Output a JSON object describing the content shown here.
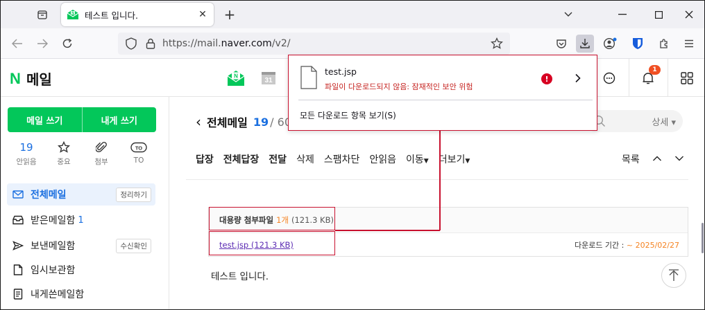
{
  "browser": {
    "tab_title": "테스트 입니다.",
    "url_prefix": "https://mail.",
    "url_domain": "naver.com",
    "url_path": "/v2/"
  },
  "download": {
    "file_name": "test.jsp",
    "status": "파일이 다운로드되지 않음: 잠재적인 보안 위험",
    "show_all": "모든 다운로드 항목 보기(S)"
  },
  "header": {
    "logo_letter": "N",
    "logo_text": "메일",
    "bell_badge": "1"
  },
  "sidebar": {
    "write_mail": "메일 쓰기",
    "write_self": "내게 쓰기",
    "quick": [
      {
        "value": "19",
        "label": "안읽음"
      },
      {
        "label": "중요"
      },
      {
        "label": "첨부"
      },
      {
        "value": "TO",
        "label": "TO"
      }
    ],
    "folders": [
      {
        "label": "전체메일",
        "button": "정리하기"
      },
      {
        "label": "받은메일함",
        "count": "1"
      },
      {
        "label": "보낸메일함",
        "button": "수신확인"
      },
      {
        "label": "임시보관함"
      },
      {
        "label": "내게쓴메일함"
      }
    ]
  },
  "content": {
    "folder_title": "전체메일",
    "unread": "19",
    "total": "/ 60",
    "search_detail": "상세",
    "toolbar": [
      "답장",
      "전체답장",
      "전달",
      "삭제",
      "스팸차단",
      "안읽음",
      "이동",
      "더보기"
    ],
    "list_label": "목록",
    "attach_title": "대용량 첨부파일",
    "attach_count": "1개",
    "attach_size": "(121.3 KB)",
    "attach_link": "test.jsp (121.3 KB)",
    "attach_expiry_label": "다운로드 기간 :",
    "attach_expiry_date": "~ 2025/02/27",
    "body": "테스트 입니다."
  },
  "colors": {
    "naver_green": "#03c75a",
    "accent_blue": "#1a6fe0",
    "highlight_red": "#c8102e"
  }
}
